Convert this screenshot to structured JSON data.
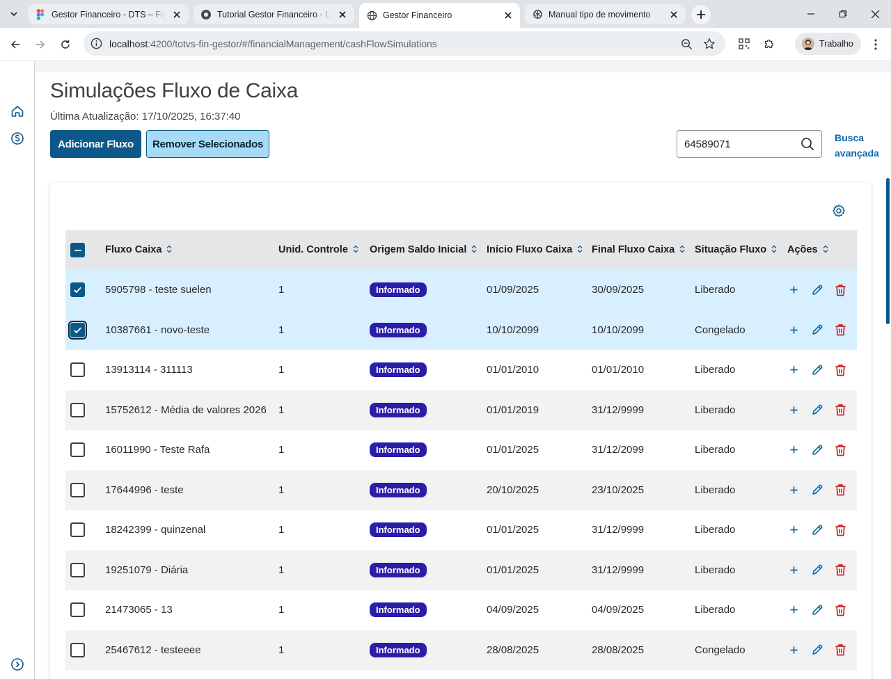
{
  "browser": {
    "tabs": [
      {
        "title": "Gestor Financeiro - DTS – Figma",
        "icon": "figma-icon",
        "active": false
      },
      {
        "title": "Tutorial Gestor Financeiro - Link",
        "icon": "loom-icon",
        "active": false
      },
      {
        "title": "Gestor Financeiro",
        "icon": "globe-icon",
        "active": true
      },
      {
        "title": "Manual tipo de movimento",
        "icon": "openai-icon",
        "active": false
      }
    ],
    "url_host": "localhost",
    "url_rest": ":4200/totvs-fin-gestor/#/financialManagement/cashFlowSimulations",
    "profile_name": "Trabalho"
  },
  "page": {
    "title": "Simulações Fluxo de Caixa",
    "last_update": "Última Atualização: 17/10/2025, 16:37:40",
    "add_button": "Adicionar Fluxo",
    "remove_button": "Remover Selecionados",
    "search_value": "64589071",
    "advanced_search_line1": "Busca",
    "advanced_search_line2": "avançada"
  },
  "table": {
    "columns": [
      "Fluxo Caixa",
      "Unid. Controle",
      "Origem Saldo Inicial",
      "Início Fluxo Caixa",
      "Final Fluxo Caixa",
      "Situação Fluxo",
      "Ações"
    ],
    "rows": [
      {
        "fluxo": "5905798 - teste suelen",
        "unid": "1",
        "origem": "Informado",
        "inicio": "01/09/2025",
        "final": "30/09/2025",
        "situacao": "Liberado",
        "selected": true
      },
      {
        "fluxo": "10387661 - novo-teste",
        "unid": "1",
        "origem": "Informado",
        "inicio": "10/10/2099",
        "final": "10/10/2099",
        "situacao": "Congelado",
        "selected": true
      },
      {
        "fluxo": "13913114 - 311113",
        "unid": "1",
        "origem": "Informado",
        "inicio": "01/01/2010",
        "final": "01/01/2010",
        "situacao": "Liberado",
        "selected": false
      },
      {
        "fluxo": "15752612 - Média de valores 2026",
        "unid": "1",
        "origem": "Informado",
        "inicio": "01/01/2019",
        "final": "31/12/9999",
        "situacao": "Liberado",
        "selected": false
      },
      {
        "fluxo": "16011990 - Teste Rafa",
        "unid": "1",
        "origem": "Informado",
        "inicio": "01/01/2025",
        "final": "31/12/2099",
        "situacao": "Liberado",
        "selected": false
      },
      {
        "fluxo": "17644996 - teste",
        "unid": "1",
        "origem": "Informado",
        "inicio": "20/10/2025",
        "final": "23/10/2025",
        "situacao": "Liberado",
        "selected": false
      },
      {
        "fluxo": "18242399 - quinzenal",
        "unid": "1",
        "origem": "Informado",
        "inicio": "01/01/2025",
        "final": "31/12/9999",
        "situacao": "Liberado",
        "selected": false
      },
      {
        "fluxo": "19251079 - Diária",
        "unid": "1",
        "origem": "Informado",
        "inicio": "01/01/2025",
        "final": "31/12/9999",
        "situacao": "Liberado",
        "selected": false
      },
      {
        "fluxo": "21473065 - 13",
        "unid": "1",
        "origem": "Informado",
        "inicio": "04/09/2025",
        "final": "04/09/2025",
        "situacao": "Liberado",
        "selected": false
      },
      {
        "fluxo": "25467612 - testeeee",
        "unid": "1",
        "origem": "Informado",
        "inicio": "28/08/2025",
        "final": "28/08/2025",
        "situacao": "Congelado",
        "selected": false
      }
    ]
  },
  "colors": {
    "primary": "#0c5989",
    "secondary_bg": "#a6dbf7",
    "tag": "#2a1ea8",
    "selected_row": "#d8efff",
    "delete_icon": "#c8222b",
    "action_icon": "#0c6aa6"
  }
}
